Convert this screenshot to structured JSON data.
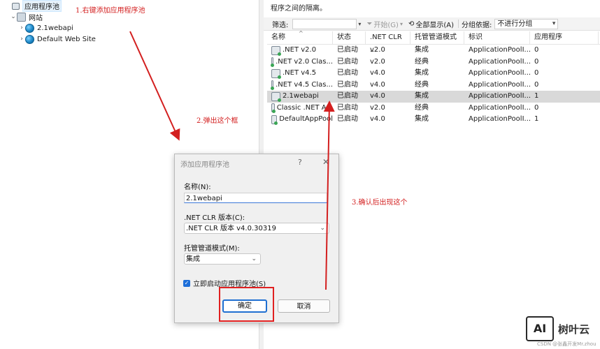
{
  "tree": {
    "items": [
      {
        "label": "应用程序池",
        "icon": "app-pool-icon",
        "indent": 0,
        "selected": true
      },
      {
        "label": "网站",
        "icon": "sites-icon",
        "indent": 0,
        "expanded": true
      },
      {
        "label": "2.1webapi",
        "icon": "globe-icon",
        "indent": 1
      },
      {
        "label": "Default Web Site",
        "icon": "globe-icon",
        "indent": 1
      }
    ]
  },
  "right": {
    "description_line2": "程序之间的隔离。",
    "filter": {
      "label": "筛选:",
      "start_label": "开始(G)",
      "show_all_label": "全部显示(A)",
      "group_by_label": "分组依据:",
      "group_by_value": "不进行分组"
    },
    "columns": [
      "名称",
      "状态",
      ".NET CLR ...",
      "托管管道模式",
      "标识",
      "应用程序"
    ],
    "rows": [
      {
        "name": ".NET v2.0",
        "status": "已启动",
        "clr": "v2.0",
        "mode": "集成",
        "identity": "ApplicationPoolI...",
        "apps": "0",
        "selected": false
      },
      {
        "name": ".NET v2.0 Clas...",
        "status": "已启动",
        "clr": "v2.0",
        "mode": "经典",
        "identity": "ApplicationPoolI...",
        "apps": "0",
        "selected": false
      },
      {
        "name": ".NET v4.5",
        "status": "已启动",
        "clr": "v4.0",
        "mode": "集成",
        "identity": "ApplicationPoolI...",
        "apps": "0",
        "selected": false
      },
      {
        "name": ".NET v4.5 Clas...",
        "status": "已启动",
        "clr": "v4.0",
        "mode": "经典",
        "identity": "ApplicationPoolI...",
        "apps": "0",
        "selected": false
      },
      {
        "name": "2.1webapi",
        "status": "已启动",
        "clr": "v4.0",
        "mode": "集成",
        "identity": "ApplicationPoolI...",
        "apps": "1",
        "selected": true
      },
      {
        "name": "Classic .NET A...",
        "status": "已启动",
        "clr": "v2.0",
        "mode": "经典",
        "identity": "ApplicationPoolI...",
        "apps": "0",
        "selected": false
      },
      {
        "name": "DefaultAppPool",
        "status": "已启动",
        "clr": "v4.0",
        "mode": "集成",
        "identity": "ApplicationPoolI...",
        "apps": "1",
        "selected": false
      }
    ]
  },
  "dialog": {
    "title": "添加应用程序池",
    "help": "?",
    "close": "✕",
    "name_label": "名称(N):",
    "name_value": "2.1webapi",
    "clr_label": ".NET CLR 版本(C):",
    "clr_value": ".NET CLR 版本 v4.0.30319",
    "pipeline_label": "托管管道模式(M):",
    "pipeline_value": "集成",
    "start_checkbox_label": "立即启动应用程序池(S)",
    "start_checked": true,
    "ok_label": "确定",
    "cancel_label": "取消"
  },
  "annotations": {
    "step1": "1.右键添加应用程序池",
    "step2": "2.弹出这个框",
    "step3": "3.确认后出现这个",
    "color": "#d31f1f"
  },
  "watermark": {
    "logo": "AI",
    "brand": "树叶云",
    "credit": "CSDN @张鑫开发Mr.zhou"
  }
}
